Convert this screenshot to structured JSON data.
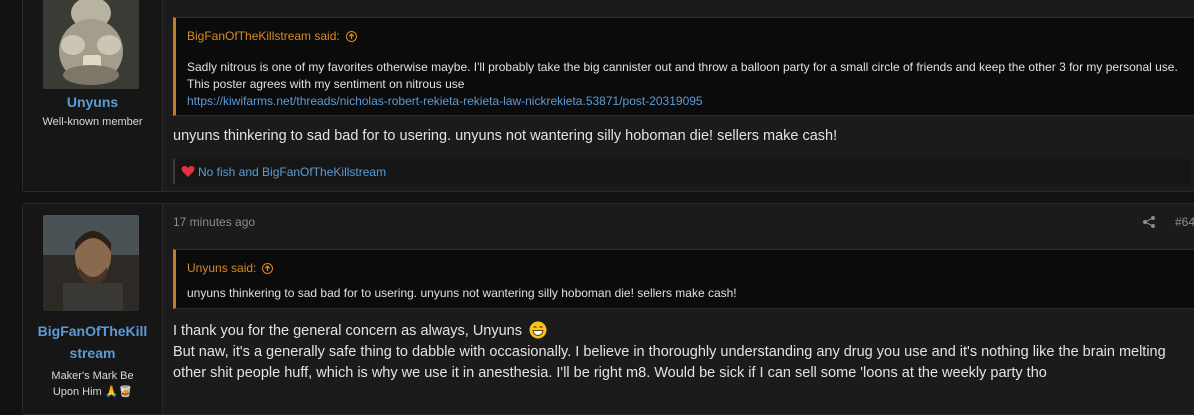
{
  "posts": [
    {
      "username": "Unyuns",
      "user_title": "Well-known member",
      "time": "",
      "post_number": "",
      "quote": {
        "author_said": "BigFanOfTheKillstream said:",
        "text": "Sadly nitrous is one of my favorites otherwise maybe. I'll probably take the big cannister out and throw a balloon party for a small circle of friends and keep the other 3 for my personal use. This poster agrees with my sentiment on nitrous use",
        "link": "https://kiwifarms.net/threads/nicholas-robert-rekieta-rekieta-law-nickrekieta.53871/post-20319095"
      },
      "message": "unyuns thinkering to sad bad for to usering. unyuns not wantering silly hoboman die! sellers make cash!",
      "reactions": "No fish and BigFanOfTheKillstream"
    },
    {
      "username_line1": "BigFanOfTheKill",
      "username_line2": "stream",
      "user_title_line1": "Maker's Mark Be",
      "user_title_line2": "Upon Him",
      "time": "17 minutes ago",
      "post_number": "#64",
      "quote": {
        "author_said": "Unyuns said:",
        "text": "unyuns thinkering to sad bad for to usering. unyuns not wantering silly hoboman die! sellers make cash!"
      },
      "message_line1": "I thank you for the general concern as always, Unyuns",
      "message_line2": "But naw, it's a generally safe thing to dabble with occasionally. I believe in thoroughly understanding any drug you use and it's nothing like the brain melting other shit people huff, which is why we use it in anesthesia. I'll be right m8. Would be sick if I can sell some 'loons at the weekly party tho"
    }
  ],
  "colors": {
    "accent_link": "#5c9bd6",
    "quote_orange": "#d88a26",
    "background": "#121212"
  },
  "icons": {
    "share": "share-icon",
    "quote_jump": "arrow-up-circle-icon",
    "reaction": "heart-icon",
    "emoji": "grin-emoji-icon"
  }
}
